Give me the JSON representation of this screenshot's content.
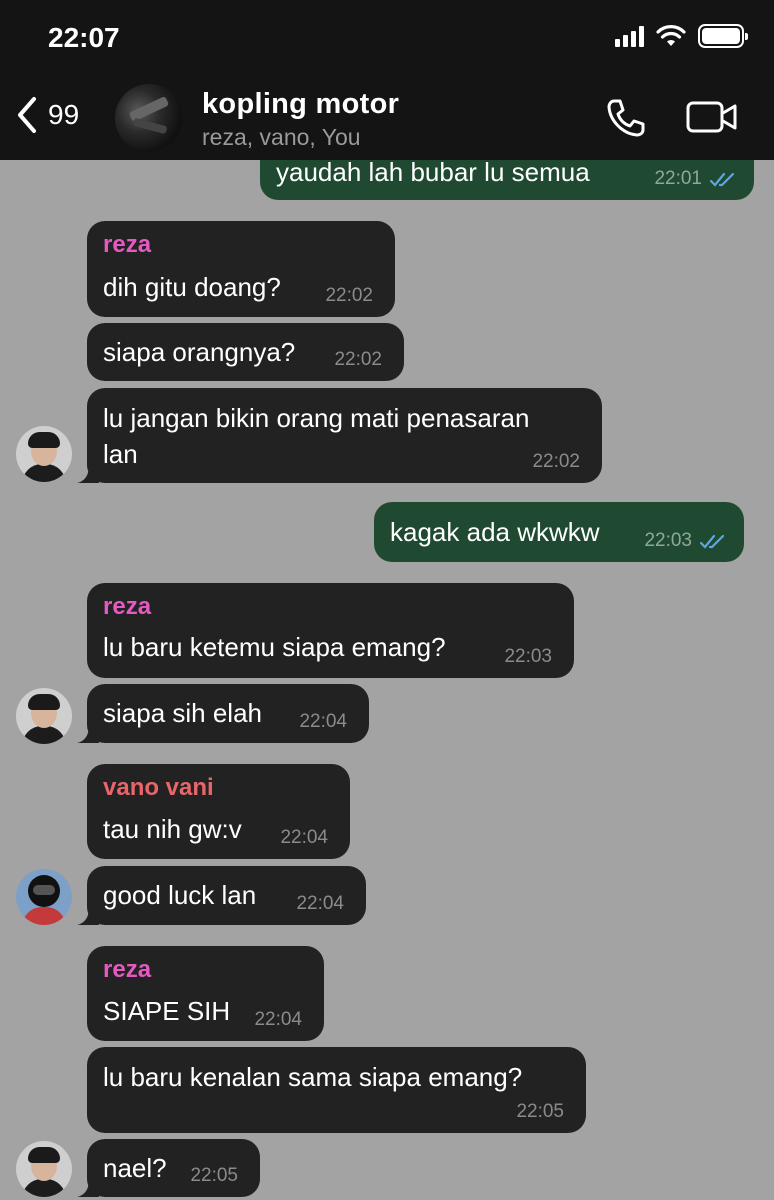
{
  "status_bar": {
    "time": "22:07"
  },
  "header": {
    "back_count": "99",
    "title": "kopling motor",
    "subtitle": "reza, vano, You"
  },
  "colors": {
    "background": "#a3a3a3",
    "incoming_bubble": "#222222",
    "outgoing_bubble": "#1f4a31",
    "reza_name": "#e45ac1",
    "vano_name": "#e8656a",
    "read_ticks": "#5aa6e6"
  },
  "messages": [
    {
      "direction": "out",
      "text": "yaudah lah bubar lu semua",
      "time": "22:01",
      "status": "read"
    },
    {
      "direction": "in",
      "sender": "reza",
      "text": "dih gitu doang?",
      "time": "22:02"
    },
    {
      "direction": "in",
      "text": "siapa orangnya?",
      "time": "22:02"
    },
    {
      "direction": "in",
      "text_line1": "lu jangan bikin orang mati penasaran",
      "text_line2": "lan",
      "time": "22:02"
    },
    {
      "direction": "out",
      "text": "kagak ada wkwkw",
      "time": "22:03",
      "status": "read"
    },
    {
      "direction": "in",
      "sender": "reza",
      "text": "lu baru ketemu siapa emang?",
      "time": "22:03"
    },
    {
      "direction": "in",
      "text": "siapa sih elah",
      "time": "22:04"
    },
    {
      "direction": "in",
      "sender": "vano vani",
      "text": "tau nih gw:v",
      "time": "22:04"
    },
    {
      "direction": "in",
      "text": "good luck lan",
      "time": "22:04"
    },
    {
      "direction": "in",
      "sender": "reza",
      "text": "SIAPE SIH",
      "time": "22:04"
    },
    {
      "direction": "in",
      "text": "lu baru kenalan sama siapa emang?",
      "time": "22:05"
    },
    {
      "direction": "in",
      "text": "nael?",
      "time": "22:05"
    }
  ]
}
